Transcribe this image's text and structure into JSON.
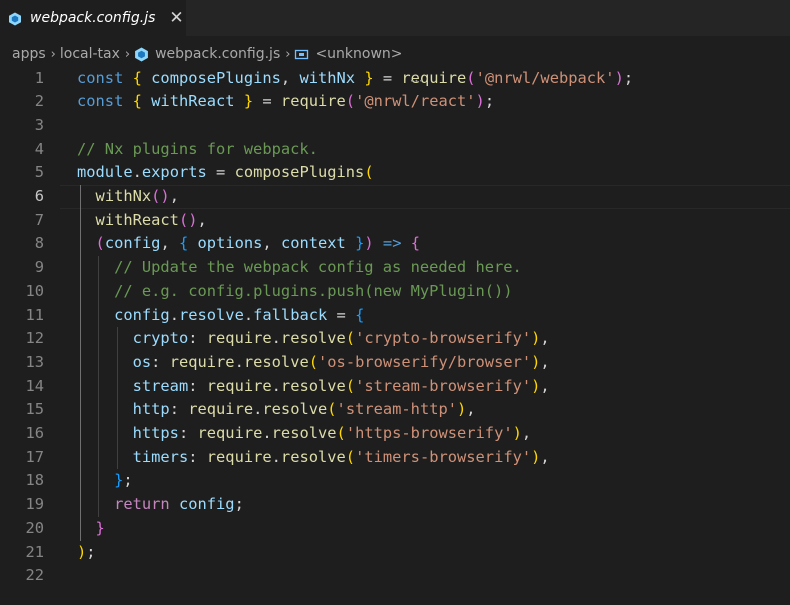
{
  "tab": {
    "title": "webpack.config.js",
    "close_glyph": "✕",
    "icon": "webpack-cube-icon"
  },
  "breadcrumb": {
    "items": [
      "apps",
      "local-tax",
      "webpack.config.js",
      "<unknown>"
    ],
    "separator": "›"
  },
  "editor": {
    "active_line": 6,
    "lines": [
      [
        [
          "k",
          "const "
        ],
        [
          "p1",
          "{ "
        ],
        [
          "v",
          "composePlugins"
        ],
        [
          "op",
          ", "
        ],
        [
          "v",
          "withNx"
        ],
        [
          "p1",
          " }"
        ],
        [
          "op",
          " = "
        ],
        [
          "f",
          "require"
        ],
        [
          "p2",
          "("
        ],
        [
          "s",
          "'@nrwl/webpack'"
        ],
        [
          "p2",
          ")"
        ],
        [
          "op",
          ";"
        ]
      ],
      [
        [
          "k",
          "const "
        ],
        [
          "p1",
          "{ "
        ],
        [
          "v",
          "withReact"
        ],
        [
          "p1",
          " }"
        ],
        [
          "op",
          " = "
        ],
        [
          "f",
          "require"
        ],
        [
          "p2",
          "("
        ],
        [
          "s",
          "'@nrwl/react'"
        ],
        [
          "p2",
          ")"
        ],
        [
          "op",
          ";"
        ]
      ],
      [],
      [
        [
          "cm",
          "// Nx plugins for webpack."
        ]
      ],
      [
        [
          "v",
          "module"
        ],
        [
          "op",
          "."
        ],
        [
          "v",
          "exports"
        ],
        [
          "op",
          " = "
        ],
        [
          "f",
          "composePlugins"
        ],
        [
          "p1",
          "("
        ]
      ],
      [
        [
          "op",
          "  "
        ],
        [
          "f",
          "withNx"
        ],
        [
          "p2",
          "()"
        ],
        [
          "op",
          ","
        ]
      ],
      [
        [
          "op",
          "  "
        ],
        [
          "f",
          "withReact"
        ],
        [
          "p2",
          "()"
        ],
        [
          "op",
          ","
        ]
      ],
      [
        [
          "op",
          "  "
        ],
        [
          "p2",
          "("
        ],
        [
          "v",
          "config"
        ],
        [
          "op",
          ", "
        ],
        [
          "p3",
          "{ "
        ],
        [
          "v",
          "options"
        ],
        [
          "op",
          ", "
        ],
        [
          "v",
          "context"
        ],
        [
          "p3",
          " }"
        ],
        [
          "p2",
          ")"
        ],
        [
          "k",
          " => "
        ],
        [
          "p2",
          "{"
        ]
      ],
      [
        [
          "op",
          "    "
        ],
        [
          "cm",
          "// Update the webpack config as needed here."
        ]
      ],
      [
        [
          "op",
          "    "
        ],
        [
          "cm",
          "// e.g. config.plugins.push(new MyPlugin())"
        ]
      ],
      [
        [
          "op",
          "    "
        ],
        [
          "v",
          "config"
        ],
        [
          "op",
          "."
        ],
        [
          "v",
          "resolve"
        ],
        [
          "op",
          "."
        ],
        [
          "v",
          "fallback"
        ],
        [
          "op",
          " = "
        ],
        [
          "p3",
          "{"
        ]
      ],
      [
        [
          "op",
          "      "
        ],
        [
          "v",
          "crypto"
        ],
        [
          "op",
          ": "
        ],
        [
          "f",
          "require"
        ],
        [
          "op",
          "."
        ],
        [
          "f",
          "resolve"
        ],
        [
          "p1",
          "("
        ],
        [
          "s",
          "'crypto-browserify'"
        ],
        [
          "p1",
          ")"
        ],
        [
          "op",
          ","
        ]
      ],
      [
        [
          "op",
          "      "
        ],
        [
          "v",
          "os"
        ],
        [
          "op",
          ": "
        ],
        [
          "f",
          "require"
        ],
        [
          "op",
          "."
        ],
        [
          "f",
          "resolve"
        ],
        [
          "p1",
          "("
        ],
        [
          "s",
          "'os-browserify/browser'"
        ],
        [
          "p1",
          ")"
        ],
        [
          "op",
          ","
        ]
      ],
      [
        [
          "op",
          "      "
        ],
        [
          "v",
          "stream"
        ],
        [
          "op",
          ": "
        ],
        [
          "f",
          "require"
        ],
        [
          "op",
          "."
        ],
        [
          "f",
          "resolve"
        ],
        [
          "p1",
          "("
        ],
        [
          "s",
          "'stream-browserify'"
        ],
        [
          "p1",
          ")"
        ],
        [
          "op",
          ","
        ]
      ],
      [
        [
          "op",
          "      "
        ],
        [
          "v",
          "http"
        ],
        [
          "op",
          ": "
        ],
        [
          "f",
          "require"
        ],
        [
          "op",
          "."
        ],
        [
          "f",
          "resolve"
        ],
        [
          "p1",
          "("
        ],
        [
          "s",
          "'stream-http'"
        ],
        [
          "p1",
          ")"
        ],
        [
          "op",
          ","
        ]
      ],
      [
        [
          "op",
          "      "
        ],
        [
          "v",
          "https"
        ],
        [
          "op",
          ": "
        ],
        [
          "f",
          "require"
        ],
        [
          "op",
          "."
        ],
        [
          "f",
          "resolve"
        ],
        [
          "p1",
          "("
        ],
        [
          "s",
          "'https-browserify'"
        ],
        [
          "p1",
          ")"
        ],
        [
          "op",
          ","
        ]
      ],
      [
        [
          "op",
          "      "
        ],
        [
          "v",
          "timers"
        ],
        [
          "op",
          ": "
        ],
        [
          "f",
          "require"
        ],
        [
          "op",
          "."
        ],
        [
          "f",
          "resolve"
        ],
        [
          "p1",
          "("
        ],
        [
          "s",
          "'timers-browserify'"
        ],
        [
          "p1",
          ")"
        ],
        [
          "op",
          ","
        ]
      ],
      [
        [
          "op",
          "    "
        ],
        [
          "p3",
          "}"
        ],
        [
          "op",
          ";"
        ]
      ],
      [
        [
          "op",
          "    "
        ],
        [
          "kc",
          "return "
        ],
        [
          "v",
          "config"
        ],
        [
          "op",
          ";"
        ]
      ],
      [
        [
          "op",
          "  "
        ],
        [
          "p2",
          "}"
        ]
      ],
      [
        [
          "p1",
          ")"
        ],
        [
          "op",
          ";"
        ]
      ],
      []
    ]
  }
}
